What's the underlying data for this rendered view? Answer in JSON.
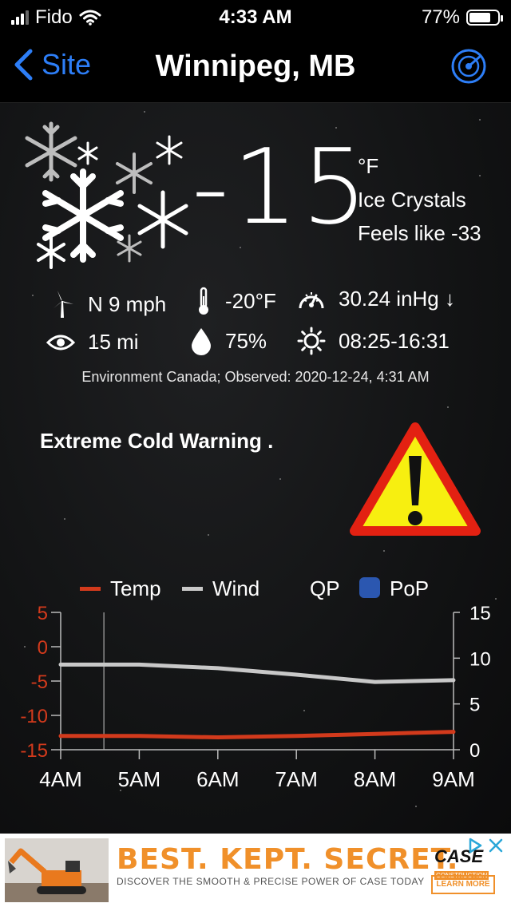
{
  "status_bar": {
    "carrier": "Fido",
    "time": "4:33 AM",
    "battery": "77%",
    "battery_level": 0.77
  },
  "nav": {
    "back_label": "Site",
    "title": "Winnipeg, MB"
  },
  "current": {
    "temperature": "-15",
    "unit": "°F",
    "condition": "Ice Crystals",
    "feels_like": "Feels like -33"
  },
  "stats": {
    "wind": "N 9 mph",
    "dewpoint": "-20°F",
    "pressure": "30.24 inHg ↓",
    "visibility": "15 mi",
    "humidity": "75%",
    "sun": "08:25-16:31"
  },
  "source": "Environment Canada; Observed: 2020-12-24, 4:31 AM",
  "warning": "Extreme Cold Warning .",
  "colors": {
    "accent": "#2d7ef7",
    "temp_line": "#d23a1c",
    "wind_line": "#c8c8c8",
    "pop": "#2b57b0"
  },
  "chart_data": {
    "type": "line",
    "legend": [
      "Temp",
      "Wind",
      "QP",
      "PoP"
    ],
    "categories": [
      "4AM",
      "5AM",
      "6AM",
      "7AM",
      "8AM",
      "9AM"
    ],
    "x": [
      4,
      5,
      6,
      7,
      8,
      9
    ],
    "series": [
      {
        "name": "Temp",
        "axis": "left",
        "values": [
          -13,
          -13,
          -13.2,
          -13,
          -12.7,
          -12.4
        ]
      },
      {
        "name": "Wind",
        "axis": "right",
        "values": [
          9.3,
          9.3,
          8.9,
          8.2,
          7.4,
          7.6
        ]
      }
    ],
    "left_axis": {
      "ticks": [
        "5",
        "0",
        "-5",
        "-10",
        "-15"
      ],
      "ylim": [
        -15,
        5
      ]
    },
    "right_axis": {
      "ticks": [
        "15",
        "10",
        "5",
        "0"
      ],
      "ylim": [
        0,
        15
      ]
    },
    "now_marker_x": 4.55
  },
  "ad": {
    "headline": "BEST. KEPT. SECRET.",
    "subline": "DISCOVER THE SMOOTH & PRECISE POWER OF CASE TODAY",
    "brand": "CASE",
    "brand_sub": "CONSTRUCTION",
    "cta": "LEARN MORE"
  }
}
